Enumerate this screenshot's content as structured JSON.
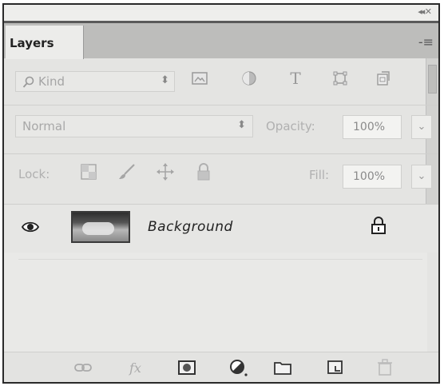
{
  "panel": {
    "tab_label": "Layers",
    "menu_icon": "panel-menu-icon"
  },
  "filter": {
    "kind_label": "Kind",
    "icons": [
      "image-filter-icon",
      "adjustment-filter-icon",
      "type-filter-icon",
      "shape-filter-icon",
      "smart-object-filter-icon"
    ]
  },
  "blend": {
    "mode": "Normal",
    "opacity_label": "Opacity:",
    "opacity_value": "100%"
  },
  "lock": {
    "label": "Lock:",
    "icons": [
      "lock-transparent-pixels-icon",
      "lock-image-pixels-icon",
      "lock-position-icon",
      "lock-all-icon"
    ],
    "fill_label": "Fill:",
    "fill_value": "100%"
  },
  "layers": [
    {
      "name": "Background",
      "visible": true,
      "locked": true
    }
  ],
  "bottom_toolbar": [
    "link-layers-icon",
    "fx-icon",
    "add-mask-icon",
    "adjustment-layer-icon",
    "new-group-icon",
    "new-layer-icon",
    "delete-layer-icon"
  ]
}
